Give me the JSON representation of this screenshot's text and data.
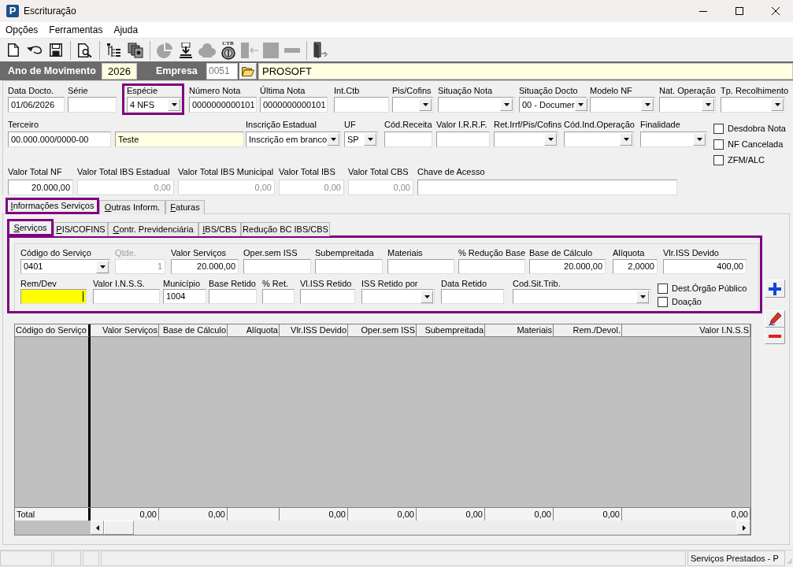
{
  "window": {
    "logo": "P",
    "title": "Escrituração"
  },
  "menu": [
    "Opções",
    "Ferramentas",
    "Ajuda"
  ],
  "toolbar": [
    {
      "kind": "new",
      "disabled": false
    },
    {
      "kind": "undo",
      "disabled": false
    },
    {
      "kind": "save",
      "disabled": false
    },
    {
      "kind": "separator"
    },
    {
      "kind": "preview",
      "disabled": false
    },
    {
      "kind": "separator"
    },
    {
      "kind": "tree",
      "disabled": false
    },
    {
      "kind": "pages",
      "disabled": false
    },
    {
      "kind": "separator"
    },
    {
      "kind": "pie",
      "disabled": true
    },
    {
      "kind": "download",
      "disabled": false
    },
    {
      "kind": "cloud",
      "disabled": true
    },
    {
      "kind": "coin",
      "label": "CTB",
      "disabled": false
    },
    {
      "kind": "document",
      "disabled": true
    },
    {
      "kind": "square",
      "disabled": true
    },
    {
      "kind": "bar",
      "disabled": true
    },
    {
      "kind": "separator"
    },
    {
      "kind": "exit",
      "disabled": false
    }
  ],
  "header": {
    "year_label": "Ano de Movimento",
    "year": "2026",
    "company_label": "Empresa",
    "company_code": "0051",
    "company_name": "PROSOFT"
  },
  "document_fields": [
    {
      "label": "Data Docto.",
      "kind": "text",
      "value": "01/06/2026",
      "highlighted": false
    },
    {
      "label": "Série",
      "kind": "text",
      "highlighted": false
    },
    {
      "label": "Espécie",
      "kind": "select",
      "value": "4 NFS",
      "highlighted": true
    },
    {
      "label": "Número Nota",
      "kind": "text",
      "value": "0000000000101",
      "highlighted": false
    },
    {
      "label": "Última Nota",
      "kind": "text",
      "value": "0000000000101",
      "highlighted": false
    },
    {
      "label": "Int.Ctb",
      "kind": "text",
      "highlighted": false
    },
    {
      "label": "Pis/Cofins",
      "kind": "select",
      "highlighted": false
    },
    {
      "label": "Situação Nota",
      "kind": "select",
      "highlighted": false
    },
    {
      "label": "Situação Docto",
      "kind": "select",
      "value": "00 - Documer",
      "highlighted": false
    },
    {
      "label": "Modelo NF",
      "kind": "select",
      "highlighted": false
    },
    {
      "label": "Nat. Operação",
      "kind": "select",
      "highlighted": false
    },
    {
      "label": "Tp. Recolhimento",
      "kind": "select",
      "highlighted": false
    }
  ],
  "party_fields": [
    {
      "label": "Terceiro",
      "kind": "text",
      "value": "00.000.000/0000-00"
    },
    {
      "kind": "readonly",
      "value": "Teste"
    },
    {
      "label": "Inscrição Estadual",
      "kind": "select",
      "value": "Inscrição em branco"
    },
    {
      "label": "UF",
      "kind": "select",
      "value": "SP"
    },
    {
      "label": "Cód.Receita",
      "kind": "text"
    },
    {
      "label": "Valor I.R.R.F.",
      "kind": "text"
    },
    {
      "label": "Ret.Irrf/Pis/Cofins",
      "kind": "select"
    },
    {
      "label": "Cód.Ind.Operação",
      "kind": "select"
    },
    {
      "label": "Finalidade",
      "kind": "select"
    }
  ],
  "totals_fields": [
    {
      "label": "Valor Total NF",
      "kind": "text",
      "value": "20.000,00"
    },
    {
      "label": "Valor Total IBS Estadual",
      "kind": "inactive",
      "value": "0,00"
    },
    {
      "label": "Valor Total IBS Municipal",
      "kind": "inactive",
      "value": "0,00"
    },
    {
      "label": "Valor Total IBS",
      "kind": "inactive",
      "value": "0,00"
    },
    {
      "label": "Valor Total CBS",
      "kind": "inactive",
      "value": "0,00"
    },
    {
      "label": "Chave de Acesso",
      "kind": "text"
    }
  ],
  "flags": [
    {
      "label": "Desdobra Nota",
      "checked": false
    },
    {
      "label": "NF Cancelada",
      "checked": false
    },
    {
      "label": "ZFM/ALC",
      "checked": false
    }
  ],
  "tabs": [
    {
      "label": "Informações Serviços",
      "selected": true,
      "highlighted": true,
      "mnemonic": true
    },
    {
      "label": "Outras Inform.",
      "selected": false,
      "highlighted": false,
      "mnemonic": true
    },
    {
      "label": "Faturas",
      "selected": false,
      "highlighted": false,
      "mnemonic": true
    }
  ],
  "service_tabs": [
    {
      "label": "Serviços",
      "selected": true,
      "highlighted": true,
      "mnemonic": true
    },
    {
      "label": "PIS/COFINS",
      "selected": false,
      "highlighted": false,
      "mnemonic": true
    },
    {
      "label": "Contr. Previdenciária",
      "selected": false,
      "highlighted": false,
      "mnemonic": true
    },
    {
      "label": "IBS/CBS",
      "selected": false,
      "highlighted": false,
      "mnemonic": true
    },
    {
      "label": "Redução BC IBS/CBS",
      "selected": false,
      "highlighted": false,
      "mnemonic": false
    }
  ],
  "services": {
    "highlighted": true,
    "fields": [
      {
        "label": "Código do Serviço",
        "kind": "select",
        "value": "0401"
      },
      {
        "label": "Qtde.",
        "kind": "disabled",
        "value": "1"
      },
      {
        "label": "Valor Serviços",
        "kind": "text",
        "value": "20.000,00"
      },
      {
        "label": "Oper.sem ISS",
        "kind": "text"
      },
      {
        "label": "Subempreitada",
        "kind": "text"
      },
      {
        "label": "Materiais",
        "kind": "text"
      },
      {
        "label": "% Redução Base",
        "kind": "text"
      },
      {
        "label": "Base de Cálculo",
        "kind": "text",
        "value": "20.000,00"
      },
      {
        "label": "Alíquota",
        "kind": "text",
        "value": "2,0000"
      },
      {
        "label": "Vlr.ISS Devido",
        "kind": "text",
        "value": "400,00"
      }
    ],
    "retention_fields": [
      {
        "label": "Rem/Dev",
        "kind": "text",
        "focused": true
      },
      {
        "label": "Valor I.N.S.S.",
        "kind": "text",
        "focused": false
      },
      {
        "label": "Município",
        "kind": "text",
        "value": "1004",
        "focused": false
      },
      {
        "label": "Base Retido",
        "kind": "text",
        "focused": false
      },
      {
        "label": "% Ret.",
        "kind": "text",
        "focused": false
      },
      {
        "label": "Vl.ISS Retido",
        "kind": "text",
        "focused": false
      },
      {
        "label": "ISS Retido por",
        "kind": "select",
        "focused": false
      },
      {
        "label": "Data Retido",
        "kind": "text",
        "focused": false
      },
      {
        "label": "Cod.Sit.Trib.",
        "kind": "select",
        "focused": false
      }
    ],
    "flags": [
      {
        "label": "Dest.Órgão Público",
        "checked": false
      },
      {
        "label": "Doação",
        "checked": false
      }
    ]
  },
  "grid": {
    "columns": [
      {
        "label": "Código do Serviço",
        "total": "Total"
      },
      {
        "label": "Valor Serviços",
        "total": "0,00"
      },
      {
        "label": "Base de Cálculo",
        "total": "0,00"
      },
      {
        "label": "Alíquota"
      },
      {
        "label": "Vlr.ISS Devido",
        "total": "0,00"
      },
      {
        "label": "Oper.sem ISS",
        "total": "0,00"
      },
      {
        "label": "Subempreitada",
        "total": "0,00"
      },
      {
        "label": "Materiais",
        "total": "0,00"
      },
      {
        "label": "Rem./Devol.",
        "total": "0,00"
      },
      {
        "label": "Valor I.N.S.S",
        "total": "0,00"
      }
    ]
  },
  "status_bar": {
    "text": "Serviços Prestados - P"
  }
}
